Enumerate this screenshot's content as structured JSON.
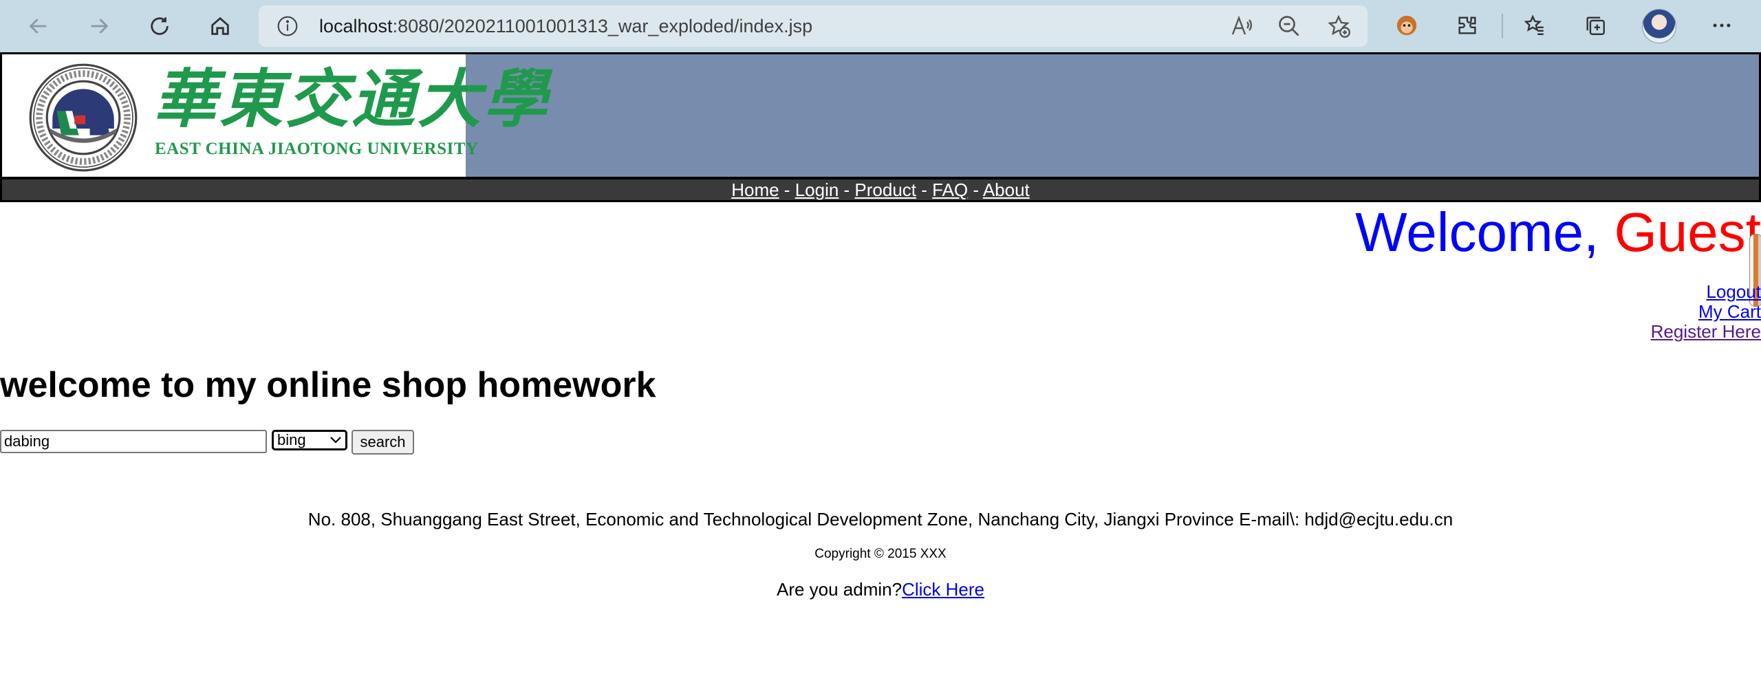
{
  "browser": {
    "url_host": "localhost",
    "url_path": ":8080/2020211001001313_war_exploded/index.jsp"
  },
  "banner": {
    "logo_cn": "華東交通大學",
    "logo_en": "EAST CHINA JIAOTONG UNIVERSITY"
  },
  "menu": {
    "items": [
      "Home",
      "Login",
      "Product",
      "FAQ",
      "About"
    ],
    "separator": " - "
  },
  "welcome": {
    "prefix": "Welcome, ",
    "name": "Guest"
  },
  "user_links": {
    "logout": "Logout",
    "cart": "My Cart",
    "register": "Register Here"
  },
  "main": {
    "title": "welcome to my online shop homework",
    "search_value": "dabing",
    "engine_selected": "bing",
    "search_button": "search"
  },
  "footer": {
    "address": "No. 808, Shuanggang East Street, Economic and Technological Development Zone, Nanchang City, Jiangxi Province E-mail\\: hdjd@ecjtu.edu.cn",
    "copyright": "Copyright © 2015 XXX",
    "admin_prompt": "Are you admin?",
    "admin_link": "Click Here"
  },
  "colors": {
    "chrome_bg": "#c7dbe6",
    "banner_bg": "#788cad",
    "menubar_bg": "#3a3a3a",
    "welcome_blue": "#0000ff",
    "guest_red": "#ff0000",
    "logo_green": "#1f9a4c"
  }
}
